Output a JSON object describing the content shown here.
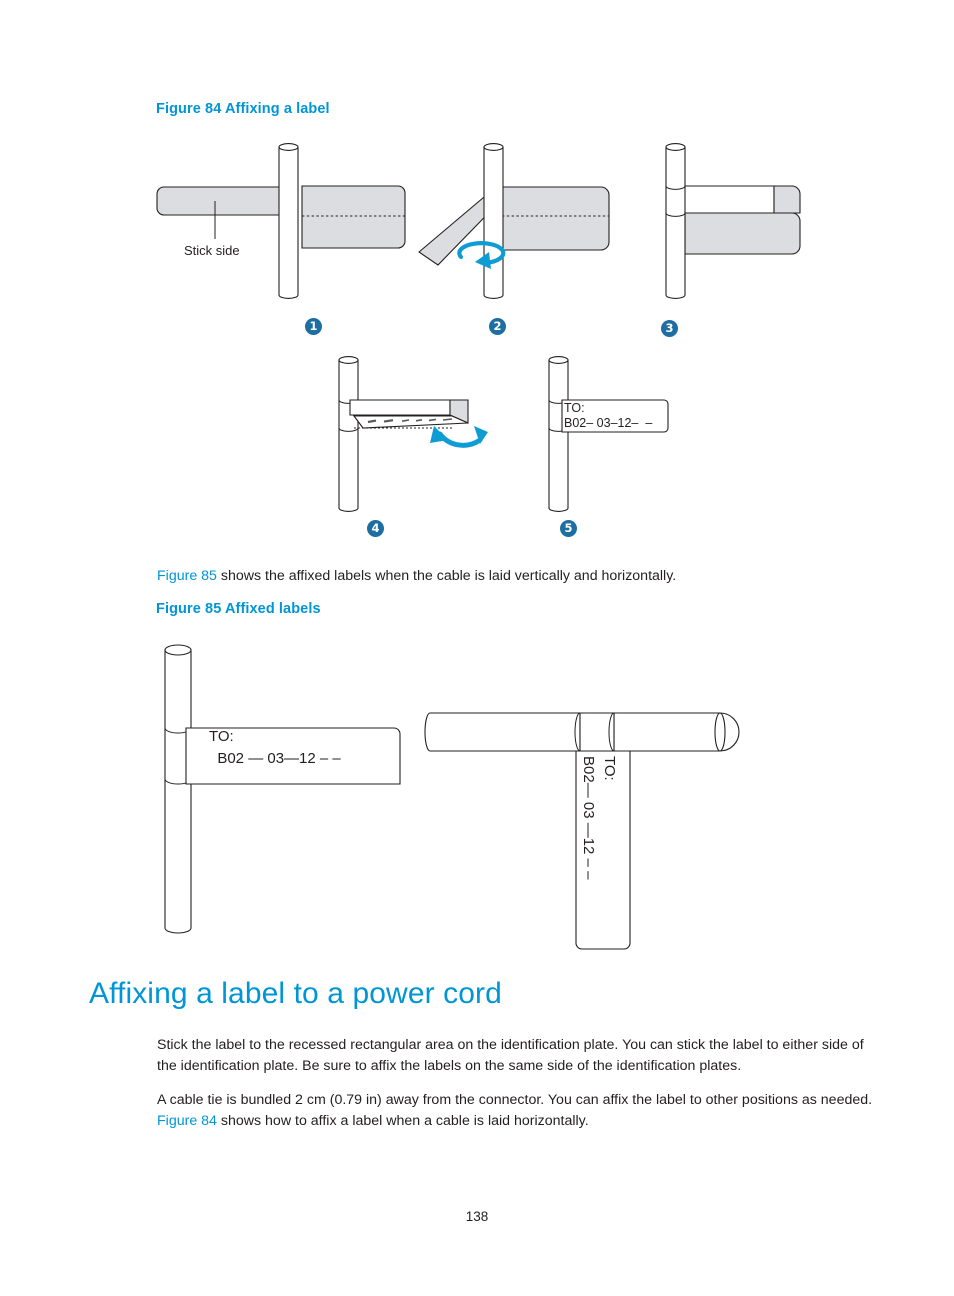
{
  "page": {
    "number": "138"
  },
  "figure84": {
    "caption": "Figure 84 Affixing a label",
    "annotation_stick_side": "Stick side",
    "steps": [
      {
        "badge": "❶",
        "number": "1"
      },
      {
        "badge": "❷",
        "number": "2"
      },
      {
        "badge": "❸",
        "number": "3"
      },
      {
        "badge": "❹",
        "number": "4"
      },
      {
        "badge": "❺",
        "number": "5"
      }
    ],
    "label_line1": "TO:",
    "label_line2": "B02– 03–12–  –"
  },
  "intro_figure85": {
    "xref": "Figure 85",
    "rest": " shows the affixed labels when the cable is laid vertically and horizontally."
  },
  "figure85": {
    "caption": "Figure 85 Affixed labels",
    "vertical_label_line1": "TO:",
    "vertical_label_line2": "  B02 — 03—12 – –",
    "horizontal_label_line1": "TO:",
    "horizontal_label_line2": "B02— 03 —12 – –"
  },
  "section": {
    "heading": "Affixing a label to a power cord",
    "paragraph1": "Stick the label to the recessed rectangular area on the identification plate. You can stick the label to either side of the identification plate. Be sure to affix the labels on the same side of the identification plates.",
    "paragraph2_part1": "A cable tie is bundled 2 cm (0.79 in) away from the connector. You can affix the label to other positions as needed. ",
    "paragraph2_xref": "Figure 84",
    "paragraph2_part2": " shows how to affix a label when a cable is laid horizontally."
  },
  "colors": {
    "accent_blue": "#0096d6",
    "badge_blue": "#1d6ea3",
    "arrow_blue": "#0e9cd5",
    "label_fill": "#dcdde0",
    "outline": "#231f20"
  }
}
